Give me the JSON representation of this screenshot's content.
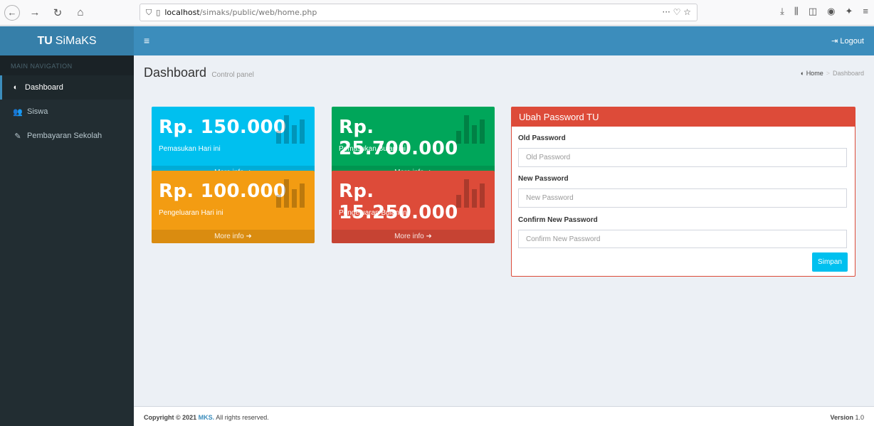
{
  "browser": {
    "url_host": "localhost",
    "url_path": "/simaks/public/web/home.php",
    "url_actions": "··· ♡ ☆"
  },
  "sidebar": {
    "brand_bold": "TU",
    "brand_rest": "SiMaKS",
    "nav_header": "MAIN NAVIGATION",
    "items": [
      {
        "label": "Dashboard",
        "icon": "dashboard-icon"
      },
      {
        "label": "Siswa",
        "icon": "users-icon"
      },
      {
        "label": "Pembayaran Sekolah",
        "icon": "edit-icon"
      }
    ]
  },
  "navbar": {
    "logout_label": "Logout"
  },
  "header": {
    "title": "Dashboard",
    "subtitle": "Control panel",
    "breadcrumb_home": "Home",
    "breadcrumb_current": "Dashboard"
  },
  "boxes": [
    {
      "amount": "Rp. 150.000",
      "label": "Pemasukan Hari ini",
      "more": "More info",
      "color": "#00c0ef"
    },
    {
      "amount": "Rp. 25.700.000",
      "label": "Pemasukan Bulan ini",
      "more": "More info",
      "color": "#00a65a"
    },
    {
      "amount": "Rp. 100.000",
      "label": "Pengeluaran Hari ini",
      "more": "More info",
      "color": "#f39c12"
    },
    {
      "amount": "Rp. 15.250.000",
      "label": "Pengeluaran Bulan ini",
      "more": "More info",
      "color": "#dd4b39"
    }
  ],
  "password_panel": {
    "title": "Ubah Password TU",
    "old_label": "Old Password",
    "old_placeholder": "Old Password",
    "new_label": "New Password",
    "new_placeholder": "New Password",
    "confirm_label": "Confirm New Password",
    "confirm_placeholder": "Confirm New Password",
    "save_label": "Simpan"
  },
  "footer": {
    "copyright_prefix": "Copyright © 2021",
    "brand": "MKS.",
    "rights": "All rights reserved.",
    "version_label": "Version",
    "version_value": "1.0"
  }
}
